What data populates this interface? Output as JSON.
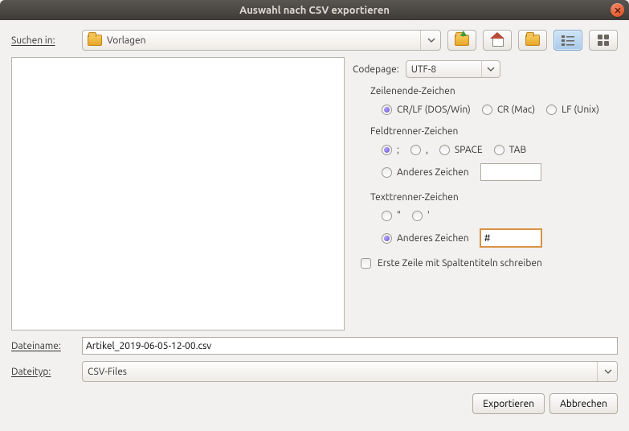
{
  "title": "Auswahl nach CSV exportieren",
  "searchIn": {
    "label": "Suchen in:",
    "value": "Vorlagen"
  },
  "codepage": {
    "label": "Codepage:",
    "value": "UTF-8"
  },
  "lineEnd": {
    "label": "Zeilenende-Zeichen",
    "opts": [
      "CR/LF (DOS/Win)",
      "CR (Mac)",
      "LF (Unix)"
    ],
    "sel": 0
  },
  "fieldSep": {
    "label": "Feldtrenner-Zeichen",
    "opts": [
      ";",
      ",",
      "SPACE",
      "TAB"
    ],
    "sel": 0,
    "otherLabel": "Anderes Zeichen",
    "otherSel": false,
    "otherVal": ""
  },
  "textSep": {
    "label": "Texttrenner-Zeichen",
    "opts": [
      "\"",
      "'"
    ],
    "sel": -1,
    "otherLabel": "Anderes Zeichen",
    "otherSel": true,
    "otherVal": "#"
  },
  "firstRow": {
    "label": "Erste Zeile mit Spaltentiteln schreiben",
    "checked": false
  },
  "filename": {
    "label": "Dateiname:",
    "value": "Artikel_2019-06-05-12-00.csv"
  },
  "filetype": {
    "label": "Dateityp:",
    "value": "CSV-Files"
  },
  "buttons": {
    "export": "Exportieren",
    "cancel": "Abbrechen"
  }
}
